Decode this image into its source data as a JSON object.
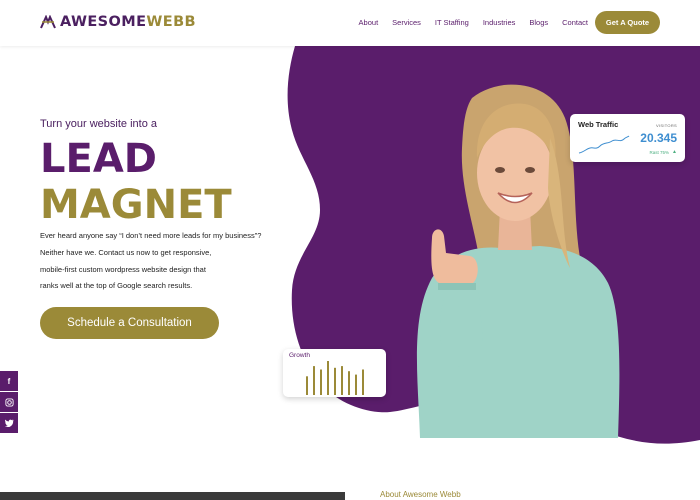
{
  "header": {
    "logo_part1": "AWESOME",
    "logo_part2": "WEBB",
    "nav": [
      "About",
      "Services",
      "IT Staffing",
      "Industries",
      "Blogs",
      "Contact"
    ],
    "quote_label": "Get A Quote"
  },
  "hero": {
    "tagline": "Turn your website into a",
    "headline_line1": "LEAD",
    "headline_line2": "MAGNET",
    "description": [
      "Ever heard anyone say “I don’t need more leads for my business”?",
      "Neither have we. Contact us now to get responsive,",
      "mobile-first custom wordpress website design that",
      "ranks well at the top of Google search results."
    ],
    "cta_label": "Schedule a Consultation"
  },
  "traffic_card": {
    "title": "Web Traffic",
    "visitors_label": "VISITORS",
    "value": "20.345",
    "change": "Rast 75%"
  },
  "growth_card": {
    "title": "Growth",
    "bars": [
      0.55,
      0.85,
      0.75,
      1.0,
      0.8,
      0.85,
      0.7,
      0.6,
      0.75
    ]
  },
  "social": {
    "facebook": "f",
    "instagram": "○",
    "twitter": "❧"
  },
  "about": {
    "title": "About Awesome Webb"
  },
  "colors": {
    "purple": "#5a1d6b",
    "gold": "#9b8a38",
    "sweater": "#9fd3c7"
  }
}
